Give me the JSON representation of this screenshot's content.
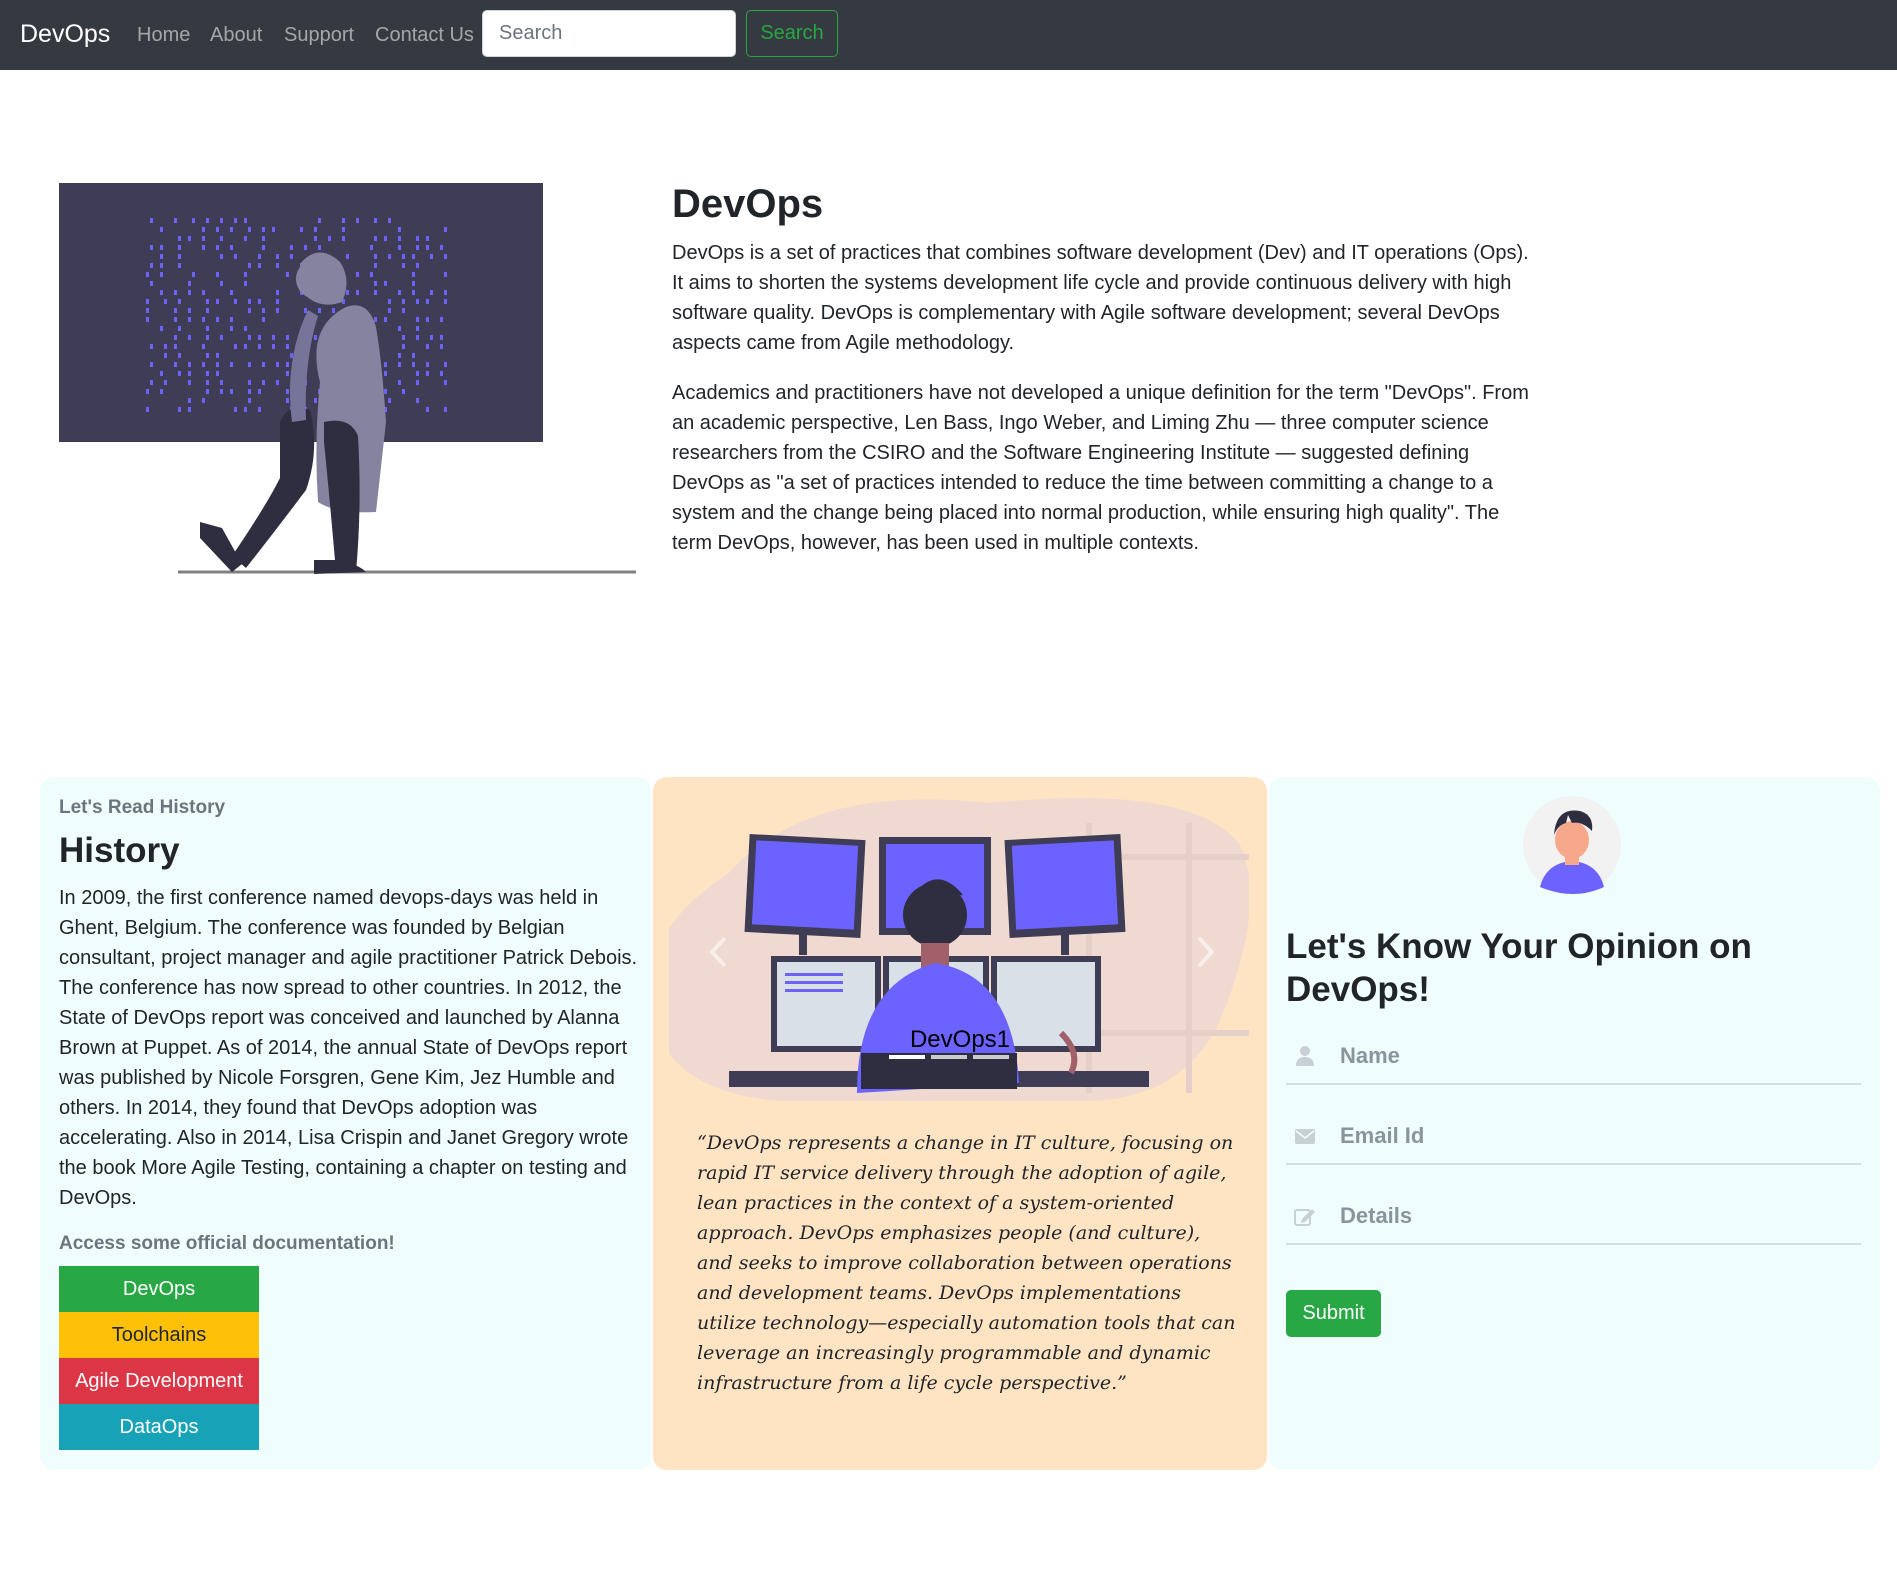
{
  "navbar": {
    "brand": "DevOps",
    "links": [
      "Home",
      "About",
      "Support",
      "Contact Us"
    ],
    "search_placeholder": "Search",
    "search_button": "Search"
  },
  "hero": {
    "title": "DevOps",
    "paragraphs": [
      "DevOps is a set of practices that combines software development (Dev) and IT operations (Ops). It aims to shorten the systems development life cycle and provide continuous delivery with high software quality. DevOps is complementary with Agile software development; several DevOps aspects came from Agile methodology.",
      "Academics and practitioners have not developed a unique definition for the term \"DevOps\". From an academic perspective, Len Bass, Ingo Weber, and Liming Zhu — three computer science researchers from the CSIRO and the Software Engineering Institute — suggested defining DevOps as \"a set of practices intended to reduce the time between committing a change to a system and the change being placed into normal production, while ensuring high quality\". The term DevOps, however, has been used in multiple contexts."
    ]
  },
  "history": {
    "subtitle": "Let's Read History",
    "title": "History",
    "text": "In 2009, the first conference named devops-days was held in Ghent, Belgium. The conference was founded by Belgian consultant, project manager and agile practitioner Patrick Debois. The conference has now spread to other countries. In 2012, the State of DevOps report was conceived and launched by Alanna Brown at Puppet. As of 2014, the annual State of DevOps report was published by Nicole Forsgren, Gene Kim, Jez Humble and others. In 2014, they found that DevOps adoption was accelerating. Also in 2014, Lisa Crispin and Janet Gregory wrote the book More Agile Testing, containing a chapter on testing and DevOps.",
    "docs_label": "Access some official documentation!",
    "doc_buttons": [
      {
        "label": "DevOps",
        "color": "#28a745"
      },
      {
        "label": "Toolchains",
        "color": "#ffc107"
      },
      {
        "label": "Agile Development",
        "color": "#dc3545"
      },
      {
        "label": "DataOps",
        "color": "#17a2b8"
      }
    ]
  },
  "carousel": {
    "caption": "DevOps1",
    "prev_icon": "chevron-left-icon",
    "next_icon": "chevron-right-icon",
    "quote": "“DevOps represents a change in IT culture, focusing on rapid IT service delivery through the adoption of agile, lean practices in the context of a system-oriented approach. DevOps emphasizes people (and culture), and seeks to improve collaboration between operations and development teams. DevOps implementations utilize technology—especially automation tools that can leverage an increasingly programmable and dynamic infrastructure from a life cycle perspective.”"
  },
  "opinion": {
    "title": "Let's Know Your Opinion on DevOps!",
    "fields": {
      "name_placeholder": "Name",
      "email_placeholder": "Email Id",
      "details_placeholder": "Details"
    },
    "submit": "Submit"
  },
  "colors": {
    "navbar_bg": "#343a40",
    "accent_green": "#28a745",
    "illustration_purple": "#6c63ff",
    "quote_card_bg": "#ffe4c4",
    "side_card_bg": "#f0fdfd"
  }
}
